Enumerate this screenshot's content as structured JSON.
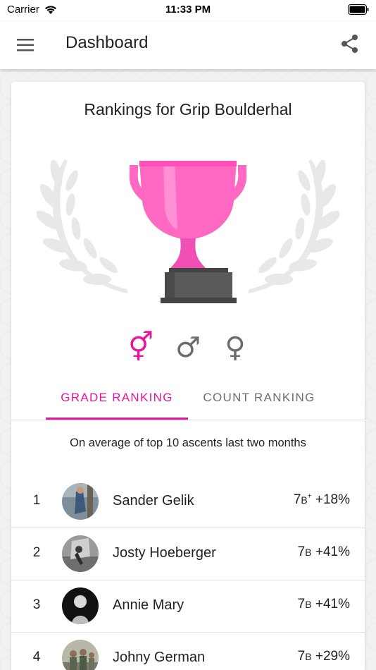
{
  "status_bar": {
    "carrier": "Carrier",
    "time": "11:33 PM"
  },
  "app_bar": {
    "title": "Dashboard"
  },
  "card": {
    "title": "Rankings for Grip Boulderhal",
    "gender_filters": [
      {
        "name": "all",
        "symbol": "⚥",
        "selected": true
      },
      {
        "name": "male",
        "symbol": "♂",
        "selected": false
      },
      {
        "name": "female",
        "symbol": "♀",
        "selected": false
      }
    ],
    "tabs": [
      {
        "label": "GRADE RANKING",
        "active": true
      },
      {
        "label": "COUNT RANKING",
        "active": false
      }
    ],
    "subtitle": "On average of top 10 ascents last two months",
    "rankings": [
      {
        "rank": "1",
        "name": "Sander Gelik",
        "grade_num": "7",
        "grade_letter": "B",
        "grade_plus": "+",
        "percent": "+18%"
      },
      {
        "rank": "2",
        "name": "Josty Hoeberger",
        "grade_num": "7",
        "grade_letter": "B",
        "grade_plus": "",
        "percent": "+41%"
      },
      {
        "rank": "3",
        "name": "Annie Mary",
        "grade_num": "7",
        "grade_letter": "B",
        "grade_plus": "",
        "percent": "+41%"
      },
      {
        "rank": "4",
        "name": "Johny German",
        "grade_num": "7",
        "grade_letter": "B",
        "grade_plus": "",
        "percent": "+29%"
      }
    ]
  },
  "colors": {
    "accent": "#e6179d",
    "trophy_pink": "#ff69c4",
    "trophy_base": "#5a5a5a",
    "laurel": "#e6e6e6",
    "inactive_icon": "#6b6b6b"
  },
  "icons": {
    "menu": "hamburger-menu-icon",
    "share": "share-icon",
    "wifi": "wifi-icon",
    "battery": "battery-icon",
    "trophy": "trophy-icon"
  }
}
